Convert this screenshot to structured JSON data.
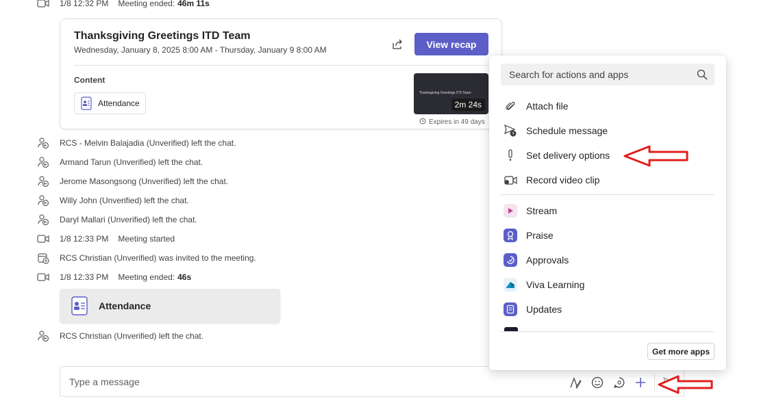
{
  "timeline": {
    "top_row": {
      "time": "1/8 12:32 PM",
      "text": "Meeting ended:",
      "duration": "46m 11s"
    },
    "recap_card": {
      "title": "Thanksgiving Greetings ITD Team",
      "subtitle": "Wednesday, January 8, 2025 8:00 AM - Thursday, January 9 8:00 AM",
      "view_recap_label": "View recap",
      "content_label": "Content",
      "attendance_label": "Attendance",
      "thumb_title": "Thanksgiving Greetings ITD Team",
      "thumb_duration": "2m 24s",
      "expires_text": "Expires in 49 days"
    },
    "events": [
      {
        "icon": "person-left-icon",
        "text": "RCS - Melvin Balajadia (Unverified) left the chat."
      },
      {
        "icon": "person-left-icon",
        "text": "Armand Tarun (Unverified) left the chat."
      },
      {
        "icon": "person-left-icon",
        "text": "Jerome Masongsong (Unverified) left the chat."
      },
      {
        "icon": "person-left-icon",
        "text": "Willy John (Unverified) left the chat."
      },
      {
        "icon": "person-left-icon",
        "text": "Daryl Mallari (Unverified) left the chat."
      }
    ],
    "meeting_started": {
      "time": "1/8 12:33 PM",
      "text": "Meeting started"
    },
    "invited": {
      "text": "RCS Christian (Unverified) was invited to the meeting."
    },
    "meeting_ended": {
      "time": "1/8 12:33 PM",
      "text": "Meeting ended:",
      "duration": "46s"
    },
    "attendance_card_label": "Attendance",
    "last_left": {
      "text": "RCS Christian (Unverified) left the chat."
    }
  },
  "compose": {
    "placeholder": "Type a message"
  },
  "actions_menu": {
    "search_placeholder": "Search for actions and apps",
    "actions": [
      {
        "icon": "paperclip-icon",
        "label": "Attach file"
      },
      {
        "icon": "schedule-send-icon",
        "label": "Schedule message"
      },
      {
        "icon": "exclamation-icon",
        "label": "Set delivery options"
      },
      {
        "icon": "video-clip-icon",
        "label": "Record video clip"
      }
    ],
    "apps": [
      {
        "icon": "stream-icon",
        "label": "Stream",
        "color": "#c43e8c"
      },
      {
        "icon": "praise-icon",
        "label": "Praise",
        "color": "#5b5fc7"
      },
      {
        "icon": "approvals-icon",
        "label": "Approvals",
        "color": "#5b5fc7"
      },
      {
        "icon": "viva-learning-icon",
        "label": "Viva Learning",
        "color": "#0f8ec4"
      },
      {
        "icon": "updates-icon",
        "label": "Updates",
        "color": "#5b5fc7"
      }
    ],
    "get_more_apps_label": "Get more apps"
  },
  "colors": {
    "accent": "#5b5fc7",
    "annotation_arrow": "#e02020"
  }
}
